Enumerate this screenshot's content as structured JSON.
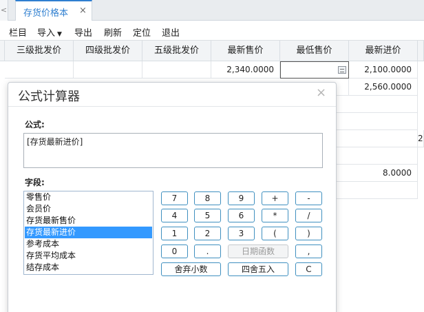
{
  "tabbar": {
    "prev_glyph": "<",
    "active_tab": "存货价格本",
    "close_glyph": "×"
  },
  "toolbar": {
    "columns": "栏目",
    "import": "导入",
    "export": "导出",
    "refresh": "刷新",
    "locate": "定位",
    "exit": "退出"
  },
  "grid": {
    "headers": [
      "三级批发价",
      "四级批发价",
      "五级批发价",
      "最新售价",
      "最低售价",
      "最新进价"
    ],
    "row1": {
      "latest_sale": "2,340.0000",
      "latest_purchase": "2,100.0000"
    },
    "row2": {
      "latest_purchase": "2,560.0000"
    },
    "row6": {
      "latest_purchase": "8.0000"
    },
    "edge_fragment": "2"
  },
  "dialog": {
    "title": "公式计算器",
    "close_glyph": "×",
    "formula_label": "公式:",
    "formula_value": "[存货最新进价]",
    "fields_label": "字段:",
    "fields": [
      "零售价",
      "会员价",
      "存货最新售价",
      "存货最新进价",
      "参考成本",
      "存货平均成本",
      "结存成本"
    ],
    "selected_field": "存货最新进价",
    "keys": {
      "k7": "7",
      "k8": "8",
      "k9": "9",
      "plus": "+",
      "minus": "-",
      "k4": "4",
      "k5": "5",
      "k6": "6",
      "mul": "*",
      "div": "/",
      "k1": "1",
      "k2": "2",
      "k3": "3",
      "lparen": "(",
      "rparen": ")",
      "k0": "0",
      "dot": ".",
      "date_func": "日期函数",
      "comma": ",",
      "truncate": "舍弃小数",
      "round": "四舍五入",
      "clear": "C"
    }
  },
  "colors": {
    "accent": "#2f7fd0",
    "button_border": "#3e8fbf",
    "selection": "#3399ff"
  }
}
